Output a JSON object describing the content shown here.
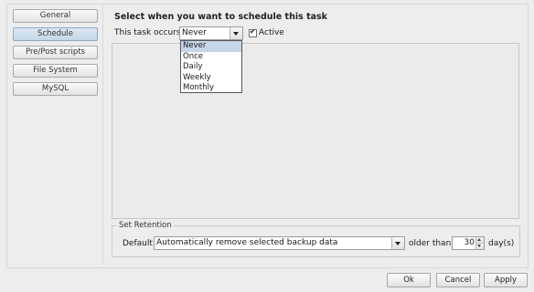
{
  "sidebar": {
    "items": [
      {
        "label": "General"
      },
      {
        "label": "Schedule"
      },
      {
        "label": "Pre/Post scripts"
      },
      {
        "label": "File System"
      },
      {
        "label": "MySQL"
      }
    ],
    "selected": "Schedule"
  },
  "schedule": {
    "heading": "Select when you want to schedule this task",
    "occurs_label": "This task occurs",
    "frequency": {
      "value": "Never",
      "options": [
        "Never",
        "Once",
        "Daily",
        "Weekly",
        "Monthly"
      ],
      "highlighted": "Never"
    },
    "active": {
      "label": "Active",
      "checked": true
    }
  },
  "retention": {
    "legend": "Set Retention",
    "default_label": "Default",
    "mode": {
      "value": "Automatically remove selected backup data"
    },
    "older_than_label": "older than",
    "days_value": "30",
    "days_unit": "day(s)"
  },
  "actions": {
    "ok": "Ok",
    "cancel": "Cancel",
    "apply": "Apply"
  },
  "colors": {
    "selected_nav": "#c4d7e8",
    "dropdown_highlight": "#c5d6e8"
  }
}
